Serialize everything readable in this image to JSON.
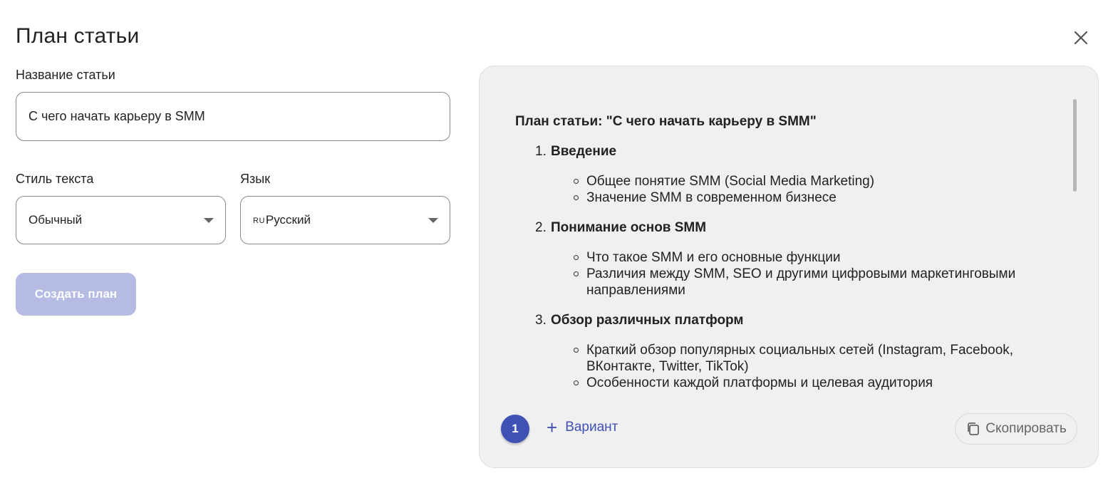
{
  "dialog": {
    "title": "План статьи",
    "close_icon": "close-icon"
  },
  "form": {
    "article_name_label": "Название статьи",
    "article_name_value": "С чего начать карьеру в SMM",
    "style_label": "Стиль текста",
    "style_value": "Обычный",
    "language_label": "Язык",
    "language_code": "RU",
    "language_value": "Русский",
    "create_button": "Создать план"
  },
  "result": {
    "heading": "План статьи: \"С чего начать карьеру в SMM\"",
    "sections": [
      {
        "number": "1.",
        "title": "Введение",
        "bullets": [
          "Общее понятие SMM (Social Media Marketing)",
          "Значение SMM в современном бизнесе"
        ]
      },
      {
        "number": "2.",
        "title": "Понимание основ SMM",
        "bullets": [
          "Что такое SMM и его основные функции",
          "Различия между SMM, SEO и другими цифровыми маркетинговыми направлениями"
        ]
      },
      {
        "number": "3.",
        "title": "Обзор различных платформ",
        "bullets": [
          "Краткий обзор популярных социальных сетей (Instagram, Facebook, ВКонтакте, Twitter, TikTok)",
          "Особенности каждой платформы и целевая аудитория"
        ]
      }
    ],
    "variant_number": "1",
    "add_variant_label": "Вариант",
    "copy_label": "Скопировать"
  },
  "colors": {
    "accent": "#3f51b5",
    "button_disabled": "#b5bbe3",
    "panel_bg": "#f0f0f0"
  }
}
